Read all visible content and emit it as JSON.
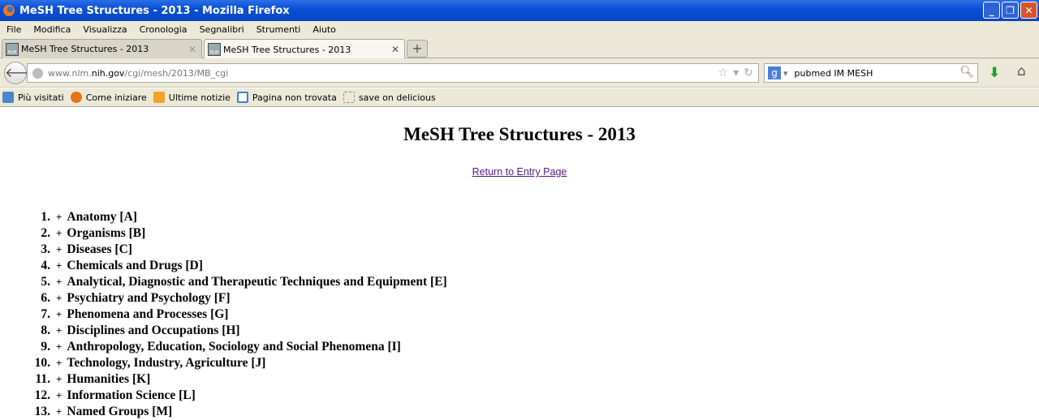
{
  "window": {
    "title": "MeSH Tree Structures - 2013 - Mozilla Firefox"
  },
  "menu": [
    "File",
    "Modifica",
    "Visualizza",
    "Cronologia",
    "Segnalibri",
    "Strumenti",
    "Aiuto"
  ],
  "tabs": [
    {
      "label": "MeSH Tree Structures - 2013",
      "active": false
    },
    {
      "label": "MeSH Tree Structures - 2013",
      "active": true
    }
  ],
  "url": {
    "host_pre": "www.nlm.",
    "host_main": "nih.gov",
    "path": "/cgi/mesh/2013/MB_cgi"
  },
  "search": {
    "value": "pubmed IM MESH",
    "engine_icon": "google-icon"
  },
  "bookmarks": [
    {
      "label": "Più visitati",
      "icon": "most-visited-icon",
      "color": "#4a86c8"
    },
    {
      "label": "Come iniziare",
      "icon": "firefox-icon",
      "color": "#e8741a"
    },
    {
      "label": "Ultime notizie",
      "icon": "rss-icon",
      "color": "#f2a12a"
    },
    {
      "label": "Pagina non trovata",
      "icon": "page-icon",
      "color": "#3b7ed6"
    },
    {
      "label": "save on delicious",
      "icon": "delicious-icon",
      "color": "#ffffff"
    }
  ],
  "page": {
    "title": "MeSH Tree Structures - 2013",
    "return_link": "Return to Entry Page",
    "items": [
      "Anatomy [A]",
      "Organisms [B]",
      "Diseases [C]",
      "Chemicals and Drugs [D]",
      "Analytical, Diagnostic and Therapeutic Techniques and Equipment [E]",
      "Psychiatry and Psychology [F]",
      "Phenomena and Processes [G]",
      "Disciplines and Occupations [H]",
      "Anthropology, Education, Sociology and Social Phenomena [I]",
      "Technology, Industry, Agriculture [J]",
      "Humanities [K]",
      "Information Science [L]",
      "Named Groups [M]"
    ]
  }
}
